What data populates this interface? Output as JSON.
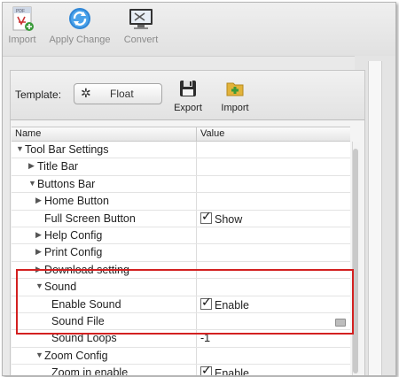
{
  "toolbar": {
    "items": [
      {
        "label": "Import",
        "icon": "pdf-import-icon"
      },
      {
        "label": "Apply Change",
        "icon": "refresh-icon"
      },
      {
        "label": "Convert",
        "icon": "monitor-convert-icon"
      }
    ]
  },
  "template_bar": {
    "label": "Template:",
    "template_value": "Float",
    "export_label": "Export",
    "import_label": "Import"
  },
  "table": {
    "headers": {
      "name": "Name",
      "value": "Value"
    },
    "rows": [
      {
        "name": "Tool Bar Settings",
        "toggle": "expanded",
        "level": 0,
        "value": ""
      },
      {
        "name": "Title Bar",
        "toggle": "collapsed",
        "level": 1,
        "value": ""
      },
      {
        "name": "Buttons Bar",
        "toggle": "expanded",
        "level": 1,
        "value": ""
      },
      {
        "name": "Home Button",
        "toggle": "collapsed",
        "level": 2,
        "value": ""
      },
      {
        "name": "Full Screen Button",
        "toggle": "none",
        "level": 2,
        "value": "Show",
        "checked": true
      },
      {
        "name": "Help Config",
        "toggle": "collapsed",
        "level": 2,
        "value": ""
      },
      {
        "name": "Print Config",
        "toggle": "collapsed",
        "level": 2,
        "value": ""
      },
      {
        "name": "Download setting",
        "toggle": "collapsed",
        "level": 2,
        "value": ""
      },
      {
        "name": "Sound",
        "toggle": "expanded",
        "level": 2,
        "value": ""
      },
      {
        "name": "Enable Sound",
        "toggle": "none",
        "level": 3,
        "value": "Enable",
        "checked": true
      },
      {
        "name": "Sound File",
        "toggle": "none",
        "level": 3,
        "value": "",
        "folder": true
      },
      {
        "name": "Sound Loops",
        "toggle": "none",
        "level": 3,
        "value": "-1"
      },
      {
        "name": "Zoom Config",
        "toggle": "expanded",
        "level": 2,
        "value": ""
      },
      {
        "name": "Zoom in enable",
        "toggle": "none",
        "level": 3,
        "value": "Enable",
        "checked": true
      }
    ]
  },
  "colors": {
    "highlight_border": "#d32020",
    "toolbar_text": "#8b8b8b"
  }
}
